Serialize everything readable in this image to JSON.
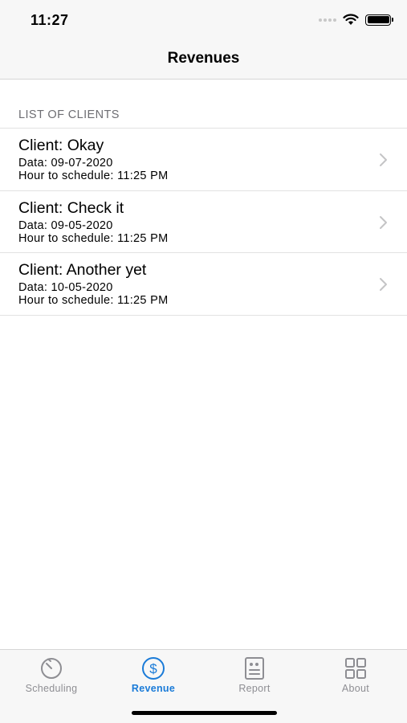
{
  "status": {
    "time": "11:27"
  },
  "nav": {
    "title": "Revenues"
  },
  "section": {
    "header": "LIST OF CLIENTS"
  },
  "clients": [
    {
      "name": "Client: Okay",
      "date": "Data: 09-07-2020",
      "hour": "Hour to schedule: 11:25 PM"
    },
    {
      "name": "Client: Check it",
      "date": "Data: 09-05-2020",
      "hour": "Hour to schedule: 11:25 PM"
    },
    {
      "name": "Client: Another yet",
      "date": "Data: 10-05-2020",
      "hour": "Hour to schedule: 11:25 PM"
    }
  ],
  "tabs": [
    {
      "label": "Scheduling",
      "icon": "timer-icon",
      "active": false
    },
    {
      "label": "Revenue",
      "icon": "dollar-circle-icon",
      "active": true
    },
    {
      "label": "Report",
      "icon": "report-icon",
      "active": false
    },
    {
      "label": "About",
      "icon": "grid-icon",
      "active": false
    }
  ],
  "colors": {
    "accent": "#1a7bd8",
    "inactive": "#8e8e93",
    "bar_bg": "#f7f7f7"
  }
}
